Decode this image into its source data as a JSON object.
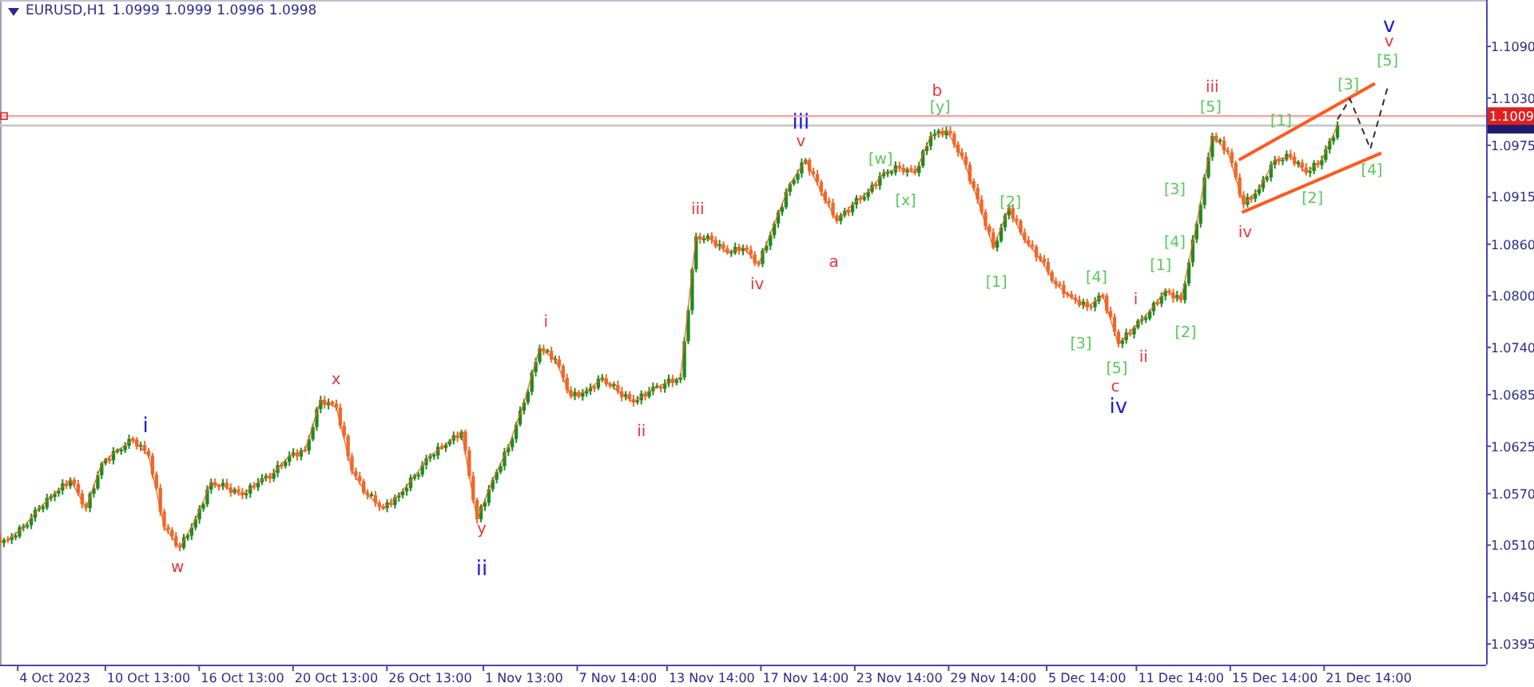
{
  "header": {
    "symbol": "EURUSD,H1",
    "quotes": [
      "1.0999",
      "1.0999",
      "1.0996",
      "1.0998"
    ]
  },
  "chart": {
    "chart_data": {
      "type": "line",
      "categories": [
        null,
        null,
        null,
        "4 Oct 2023",
        null,
        null,
        null,
        null,
        null,
        "10 Oct 13:00",
        null,
        null,
        null,
        null,
        null,
        "16 Oct 13:00",
        null,
        null,
        null,
        null,
        null,
        "20 Oct 13:00",
        null,
        null,
        null,
        null,
        null,
        "26 Oct 13:00",
        null,
        null,
        null,
        null,
        null,
        "1 Nov 13:00",
        null,
        null,
        null,
        null,
        null,
        "7 Nov 14:00",
        null,
        null,
        null,
        null,
        null,
        "13 Nov 14:00",
        null,
        null,
        null,
        null,
        null,
        "17 Nov 14:00",
        null,
        null,
        null,
        null,
        null,
        "23 Nov 14:00",
        null,
        null,
        null,
        null,
        null,
        "29 Nov 14:00",
        null,
        null,
        null,
        null,
        null,
        "5 Dec 14:00",
        null,
        null,
        null,
        null,
        null,
        "11 Dec 14:00",
        null,
        null,
        null,
        null,
        null,
        "15 Dec 14:00",
        null,
        null,
        null,
        null,
        null,
        "21 Dec 14:00",
        null,
        null,
        null,
        null,
        null,
        null,
        null
      ],
      "series": [
        {
          "color": "#ff5a1e",
          "values": [
            1.0516,
            1.0531,
            1.0553,
            1.057,
            1.0586,
            1.0553,
            1.0605,
            1.062,
            1.0633,
            1.0614,
            1.0531,
            1.0507,
            1.054,
            1.0583,
            1.0577,
            1.0568,
            1.0583,
            1.0594,
            1.0614,
            1.062,
            1.0679,
            1.067,
            1.0596,
            1.0568,
            1.0553,
            1.0568,
            1.059,
            1.0614,
            1.0627,
            1.0642,
            1.054,
            1.0586,
            1.0624,
            1.0676,
            1.0739,
            1.0726,
            1.0683,
            1.0689,
            1.0704,
            1.0689,
            1.0676,
            1.0689,
            1.0698,
            1.0705,
            1.0869,
            1.0865,
            1.085,
            1.0856,
            1.0837,
            1.0884,
            1.093,
            1.0958,
            1.0921,
            1.0887,
            1.0906,
            1.0921,
            1.0943,
            1.0949,
            1.0943,
            1.0986,
            1.0992,
            1.0962,
            1.0912,
            1.0856,
            1.0902,
            1.0865,
            1.0843,
            1.0813,
            1.0798,
            1.0787,
            1.08,
            1.0744,
            1.0763,
            1.0782,
            1.0806,
            1.0795,
            1.0884,
            1.0986,
            1.0967,
            1.0906,
            1.0925,
            1.0958,
            1.0962,
            1.0943,
            1.0958,
            1.0998,
            null,
            null,
            null,
            null,
            null,
            null,
            null,
            null,
            null
          ]
        }
      ],
      "ylim": [
        1.0371,
        1.1144
      ],
      "yticks": [
        {
          "value": 1.109,
          "label": "1.1090"
        },
        {
          "value": 1.103,
          "label": "1.1030"
        },
        {
          "value": 1.0975,
          "label": "1.0975"
        },
        {
          "value": 1.0915,
          "label": "1.0915"
        },
        {
          "value": 1.086,
          "label": "1.0860"
        },
        {
          "value": 1.08,
          "label": "1.0800"
        },
        {
          "value": 1.074,
          "label": "1.0740"
        },
        {
          "value": 1.0685,
          "label": "1.0685"
        },
        {
          "value": 1.0625,
          "label": "1.0625"
        },
        {
          "value": 1.057,
          "label": "1.0570"
        },
        {
          "value": 1.051,
          "label": "1.0510"
        },
        {
          "value": 1.045,
          "label": "1.0450"
        },
        {
          "value": 1.0395,
          "label": "1.0395"
        }
      ],
      "ref_lines": [
        {
          "axis": "y",
          "value": 1.0998
        },
        {
          "axis": "y",
          "value": 1.1009,
          "label": "1.1009"
        }
      ]
    },
    "wave_labels": [
      {
        "text": "i",
        "color": "#2020d0"
      },
      {
        "text": "w",
        "color": "#e8383d"
      },
      {
        "text": "x",
        "color": "#e8383d"
      },
      {
        "text": "y",
        "color": "#e8383d"
      },
      {
        "text": "ii",
        "color": "#2020d0"
      },
      {
        "text": "i",
        "color": "#e8383d"
      },
      {
        "text": "ii",
        "color": "#e8383d"
      },
      {
        "text": "iii",
        "color": "#e8383d"
      },
      {
        "text": "iv",
        "color": "#e8383d"
      },
      {
        "text": "iii",
        "color": "#2020d0"
      },
      {
        "text": "v",
        "color": "#e8383d"
      },
      {
        "text": "a",
        "color": "#e8383d"
      },
      {
        "text": "[w]",
        "color": "#5ac85a"
      },
      {
        "text": "[x]",
        "color": "#5ac85a"
      },
      {
        "text": "b",
        "color": "#e8383d"
      },
      {
        "text": "[y]",
        "color": "#5ac85a"
      },
      {
        "text": "[2]",
        "color": "#5ac85a"
      },
      {
        "text": "[1]",
        "color": "#5ac85a"
      },
      {
        "text": "[4]",
        "color": "#5ac85a"
      },
      {
        "text": "[3]",
        "color": "#5ac85a"
      },
      {
        "text": "i",
        "color": "#e8383d"
      },
      {
        "text": "[1]",
        "color": "#5ac85a"
      },
      {
        "text": "[5]",
        "color": "#5ac85a"
      },
      {
        "text": "ii",
        "color": "#e8383d"
      },
      {
        "text": "[2]",
        "color": "#5ac85a"
      },
      {
        "text": "c",
        "color": "#e8383d"
      },
      {
        "text": "iv",
        "color": "#2020d0"
      },
      {
        "text": "iii",
        "color": "#e8383d"
      },
      {
        "text": "[5]",
        "color": "#5ac85a"
      },
      {
        "text": "[3]",
        "color": "#5ac85a"
      },
      {
        "text": "[4]",
        "color": "#5ac85a"
      },
      {
        "text": "iv",
        "color": "#e8383d"
      },
      {
        "text": "[1]",
        "color": "#5ac85a"
      },
      {
        "text": "[2]",
        "color": "#5ac85a"
      },
      {
        "text": "[3]",
        "color": "#5ac85a"
      },
      {
        "text": "[4]",
        "color": "#5ac85a"
      },
      {
        "text": "v",
        "color": "#2020d0"
      },
      {
        "text": "v",
        "color": "#e8383d"
      },
      {
        "text": "[5]",
        "color": "#5ac85a"
      }
    ]
  }
}
